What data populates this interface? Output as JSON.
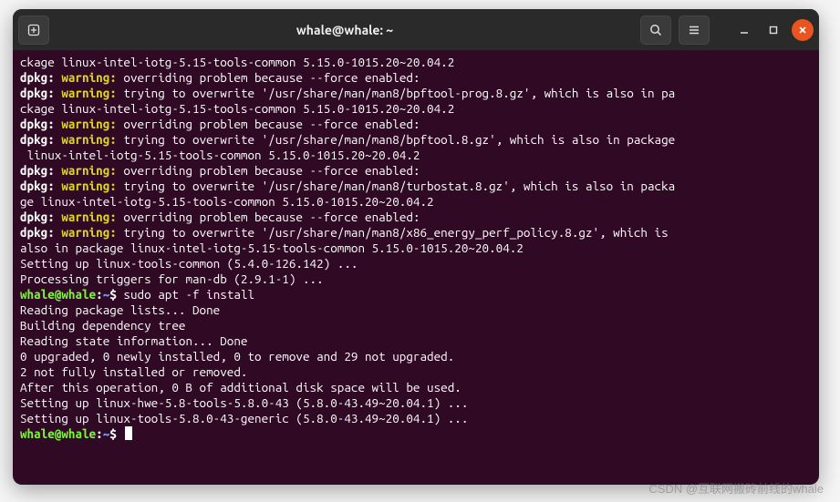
{
  "title": "whale@whale: ~",
  "watermark": "CSDN @互联网搬砖前线的whale",
  "prompt": {
    "user_host": "whale@whale",
    "colon": ":",
    "path": "~",
    "dollar": "$"
  },
  "cmd1": " sudo apt -f install",
  "lines": [
    {
      "segs": [
        {
          "t": "ckage linux-intel-iotg-5.15-tools-common 5.15.0-1015.20~20.04.2"
        }
      ]
    },
    {
      "segs": [
        {
          "t": "dpkg: ",
          "c": "bold"
        },
        {
          "t": "warning:",
          "c": "yellow"
        },
        {
          "t": " overriding problem because --force enabled:"
        }
      ]
    },
    {
      "segs": [
        {
          "t": "dpkg: ",
          "c": "bold"
        },
        {
          "t": "warning:",
          "c": "yellow"
        },
        {
          "t": " trying to overwrite '/usr/share/man/man8/bpftool-prog.8.gz', which is also in pa"
        }
      ]
    },
    {
      "segs": [
        {
          "t": "ckage linux-intel-iotg-5.15-tools-common 5.15.0-1015.20~20.04.2"
        }
      ]
    },
    {
      "segs": [
        {
          "t": "dpkg: ",
          "c": "bold"
        },
        {
          "t": "warning:",
          "c": "yellow"
        },
        {
          "t": " overriding problem because --force enabled:"
        }
      ]
    },
    {
      "segs": [
        {
          "t": "dpkg: ",
          "c": "bold"
        },
        {
          "t": "warning:",
          "c": "yellow"
        },
        {
          "t": " trying to overwrite '/usr/share/man/man8/bpftool.8.gz', which is also in package"
        }
      ]
    },
    {
      "segs": [
        {
          "t": " linux-intel-iotg-5.15-tools-common 5.15.0-1015.20~20.04.2"
        }
      ]
    },
    {
      "segs": [
        {
          "t": "dpkg: ",
          "c": "bold"
        },
        {
          "t": "warning:",
          "c": "yellow"
        },
        {
          "t": " overriding problem because --force enabled:"
        }
      ]
    },
    {
      "segs": [
        {
          "t": "dpkg: ",
          "c": "bold"
        },
        {
          "t": "warning:",
          "c": "yellow"
        },
        {
          "t": " trying to overwrite '/usr/share/man/man8/turbostat.8.gz', which is also in packa"
        }
      ]
    },
    {
      "segs": [
        {
          "t": "ge linux-intel-iotg-5.15-tools-common 5.15.0-1015.20~20.04.2"
        }
      ]
    },
    {
      "segs": [
        {
          "t": "dpkg: ",
          "c": "bold"
        },
        {
          "t": "warning:",
          "c": "yellow"
        },
        {
          "t": " overriding problem because --force enabled:"
        }
      ]
    },
    {
      "segs": [
        {
          "t": "dpkg: ",
          "c": "bold"
        },
        {
          "t": "warning:",
          "c": "yellow"
        },
        {
          "t": " trying to overwrite '/usr/share/man/man8/x86_energy_perf_policy.8.gz', which is "
        }
      ]
    },
    {
      "segs": [
        {
          "t": "also in package linux-intel-iotg-5.15-tools-common 5.15.0-1015.20~20.04.2"
        }
      ]
    },
    {
      "segs": [
        {
          "t": "Setting up linux-tools-common (5.4.0-126.142) ..."
        }
      ]
    },
    {
      "segs": [
        {
          "t": "Processing triggers for man-db (2.9.1-1) ..."
        }
      ]
    },
    {
      "prompt": true,
      "cmd_key": "cmd1"
    },
    {
      "segs": [
        {
          "t": "Reading package lists... Done"
        }
      ]
    },
    {
      "segs": [
        {
          "t": "Building dependency tree"
        }
      ]
    },
    {
      "segs": [
        {
          "t": "Reading state information... Done"
        }
      ]
    },
    {
      "segs": [
        {
          "t": "0 upgraded, 0 newly installed, 0 to remove and 29 not upgraded."
        }
      ]
    },
    {
      "segs": [
        {
          "t": "2 not fully installed or removed."
        }
      ]
    },
    {
      "segs": [
        {
          "t": "After this operation, 0 B of additional disk space will be used."
        }
      ]
    },
    {
      "segs": [
        {
          "t": "Setting up linux-hwe-5.8-tools-5.8.0-43 (5.8.0-43.49~20.04.1) ..."
        }
      ]
    },
    {
      "segs": [
        {
          "t": "Setting up linux-tools-5.8.0-43-generic (5.8.0-43.49~20.04.1) ..."
        }
      ]
    },
    {
      "prompt": true,
      "cursor": true
    }
  ]
}
